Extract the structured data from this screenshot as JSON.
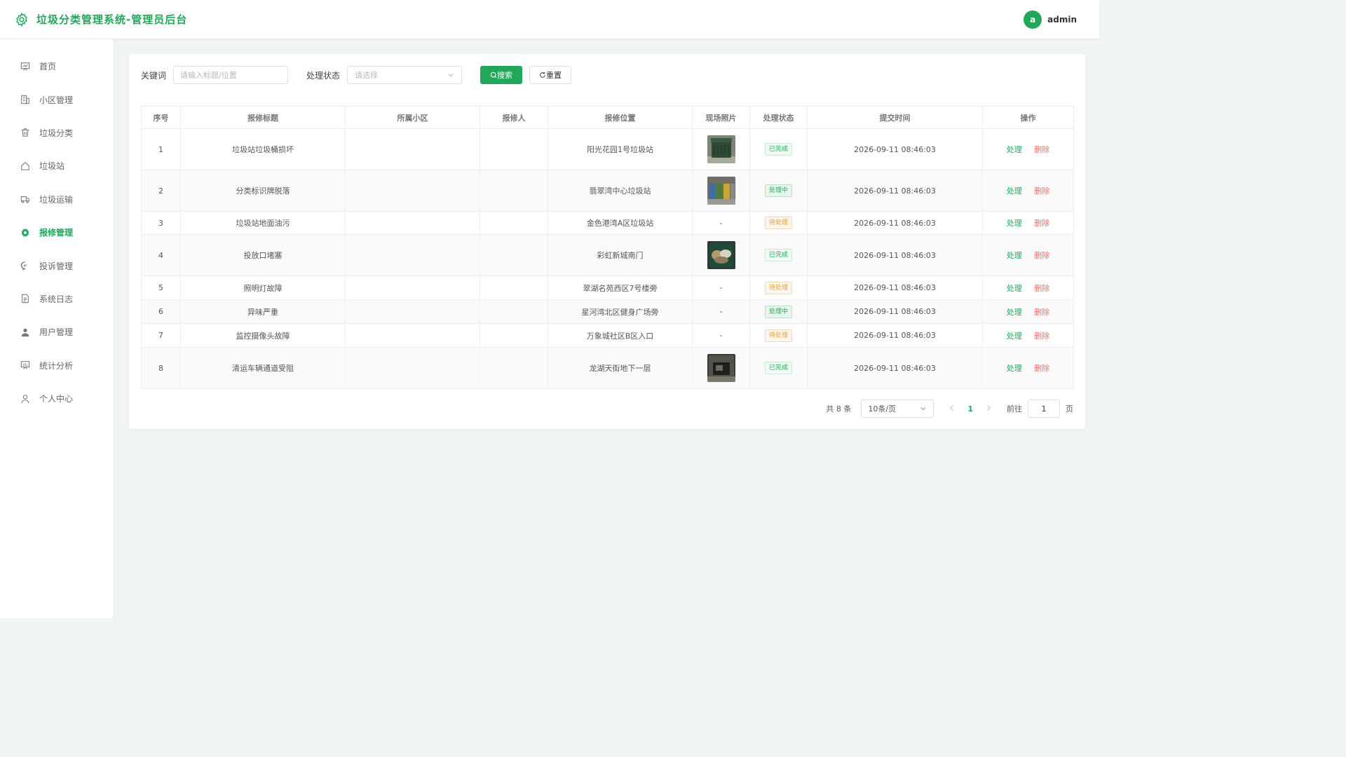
{
  "app": {
    "title": "垃圾分类管理系统-管理员后台",
    "user_initial": "a",
    "username": "admin",
    "accent": "#22a75a"
  },
  "sidebar": {
    "items": [
      {
        "label": "首页",
        "icon": "presentation-board-icon",
        "active": false
      },
      {
        "label": "小区管理",
        "icon": "building-icon",
        "active": false
      },
      {
        "label": "垃圾分类",
        "icon": "trash-can-icon",
        "active": false
      },
      {
        "label": "垃圾站",
        "icon": "house-icon",
        "active": false
      },
      {
        "label": "垃圾运输",
        "icon": "truck-icon",
        "active": false
      },
      {
        "label": "报修管理",
        "icon": "gear-icon",
        "active": true
      },
      {
        "label": "投诉管理",
        "icon": "chat-bubble-icon",
        "active": false
      },
      {
        "label": "系统日志",
        "icon": "document-icon",
        "active": false
      },
      {
        "label": "用户管理",
        "icon": "user-filled-icon",
        "active": false
      },
      {
        "label": "统计分析",
        "icon": "chart-board-icon",
        "active": false
      },
      {
        "label": "个人中心",
        "icon": "user-outline-icon",
        "active": false
      }
    ]
  },
  "filters": {
    "keyword_label": "关键词",
    "keyword_placeholder": "请输入标题/位置",
    "keyword_value": "",
    "status_label": "处理状态",
    "status_placeholder": "请选择",
    "search_label": "搜索",
    "reset_label": "重置"
  },
  "table": {
    "columns": [
      "序号",
      "报修标题",
      "所属小区",
      "报修人",
      "报修位置",
      "现场照片",
      "处理状态",
      "提交时间",
      "操作"
    ],
    "edit_label": "处理",
    "delete_label": "删除",
    "rows": [
      {
        "no": "1",
        "title": "垃圾站垃圾桶损坏",
        "community": "",
        "reporter": "",
        "location": "阳光花园1号垃圾站",
        "photo": "green-bin",
        "status": "已完成",
        "status_type": "done",
        "time": "2026-09-11 08:46:03"
      },
      {
        "no": "2",
        "title": "分类标识牌脱落",
        "community": "",
        "reporter": "",
        "location": "翡翠湾中心垃圾站",
        "photo": "sorting-bins",
        "status": "处理中",
        "status_type": "proc",
        "time": "2026-09-11 08:46:03"
      },
      {
        "no": "3",
        "title": "垃圾站地面油污",
        "community": "",
        "reporter": "",
        "location": "金色港湾A区垃圾站",
        "photo": "-",
        "status": "待处理",
        "status_type": "wait",
        "time": "2026-09-11 08:46:03"
      },
      {
        "no": "4",
        "title": "投放口堵塞",
        "community": "",
        "reporter": "",
        "location": "彩虹新城南门",
        "photo": "blocked-bin",
        "status": "已完成",
        "status_type": "done",
        "time": "2026-09-11 08:46:03"
      },
      {
        "no": "5",
        "title": "照明灯故障",
        "community": "",
        "reporter": "",
        "location": "翠湖名苑西区7号楼旁",
        "photo": "-",
        "status": "待处理",
        "status_type": "wait",
        "time": "2026-09-11 08:46:03"
      },
      {
        "no": "6",
        "title": "异味严重",
        "community": "",
        "reporter": "",
        "location": "星河湾北区健身广场旁",
        "photo": "-",
        "status": "处理中",
        "status_type": "proc",
        "time": "2026-09-11 08:46:03"
      },
      {
        "no": "7",
        "title": "监控摄像头故障",
        "community": "",
        "reporter": "",
        "location": "万象城社区B区入口",
        "photo": "-",
        "status": "待处理",
        "status_type": "wait",
        "time": "2026-09-11 08:46:03"
      },
      {
        "no": "8",
        "title": "清运车辆通道受阻",
        "community": "",
        "reporter": "",
        "location": "龙湖天街地下一层",
        "photo": "dark-tunnel",
        "status": "已完成",
        "status_type": "done",
        "time": "2026-09-11 08:46:03"
      }
    ]
  },
  "pagination": {
    "total_text": "共 8 条",
    "page_size": "10条/页",
    "current_page": "1",
    "goto_label": "前往",
    "goto_value": "1",
    "page_suffix": "页"
  }
}
